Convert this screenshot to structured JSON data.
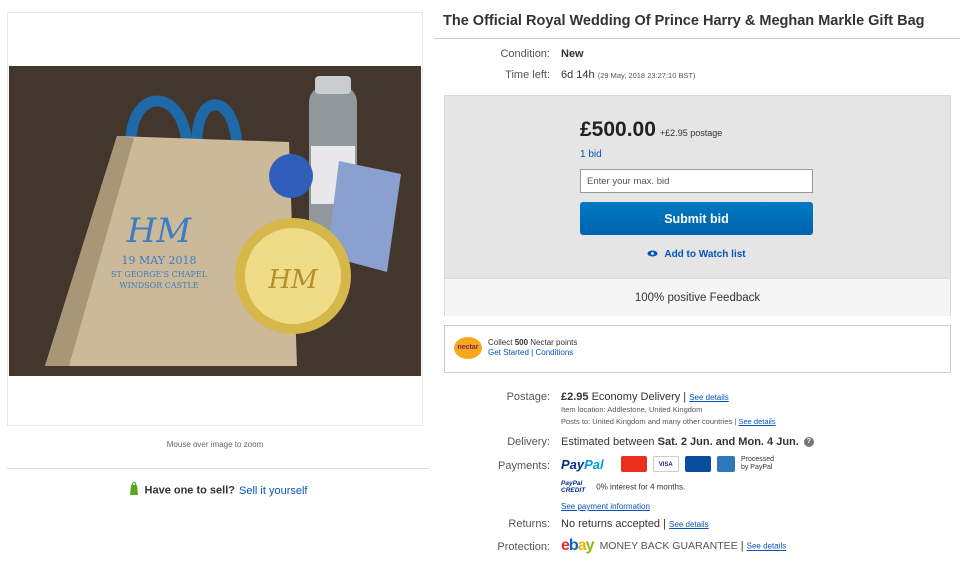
{
  "listing": {
    "title": "The Official Royal Wedding Of Prince Harry & Meghan Markle Gift Bag"
  },
  "image": {
    "zoom_hint": "Mouse over image to zoom",
    "bag_monogram": "HM",
    "bag_date": "19 MAY 2018",
    "bag_line1": "ST GEORGE'S CHAPEL",
    "bag_line2": "WINDSOR CASTLE"
  },
  "sell": {
    "question": "Have one to sell?",
    "link": "Sell it yourself"
  },
  "condition": {
    "label": "Condition:",
    "value": "New"
  },
  "time_left": {
    "label": "Time left:",
    "value": "6d 14h",
    "detail": "(29 May, 2018  23:27:10 BST)"
  },
  "bid": {
    "price": "£500.00",
    "postage": "+£2.95 postage",
    "bid_count": "1 bid",
    "placeholder": "Enter your max. bid",
    "submit": "Submit bid",
    "watch": "Add to Watch list",
    "feedback": "100% positive Feedback"
  },
  "nectar": {
    "logo": "nectar",
    "collect_prefix": "Collect ",
    "points": "500",
    "collect_suffix": " Nectar points",
    "get_started": "Get Started",
    "sep": "|",
    "conditions": "Conditions"
  },
  "postage": {
    "label": "Postage:",
    "price": "£2.95",
    "service": "Economy Delivery",
    "sep": "|",
    "see_details": "See details",
    "location": "Item location:  Addlestone, United Kingdom",
    "posts_to": "Posts to:  United Kingdom and many other countries",
    "see_details2": "See details"
  },
  "delivery": {
    "label": "Delivery:",
    "prefix": "Estimated between ",
    "range": "Sat. 2 Jun. and Mon. 4 Jun.",
    "help": "?"
  },
  "payments": {
    "label": "Payments:",
    "paypal_pay": "Pay",
    "paypal_pal": "Pal",
    "cards": [
      "mastercard",
      "VISA",
      "maestro",
      "AMEX"
    ],
    "processed": "Processed",
    "by_paypal": "by PayPal",
    "credit_a": "PayPal",
    "credit_b": "CREDIT",
    "credit_text": "0% interest for 4 months.",
    "see_payment": "See payment information"
  },
  "returns": {
    "label": "Returns:",
    "value": "No returns accepted",
    "see_details": "See details"
  },
  "protection": {
    "label": "Protection:",
    "logo": "ebay",
    "value": "MONEY BACK GUARANTEE",
    "see_details": "See details"
  },
  "colors": {
    "link": "#0654ba",
    "button": "#0070c0",
    "nectar": "#f7a81b"
  }
}
